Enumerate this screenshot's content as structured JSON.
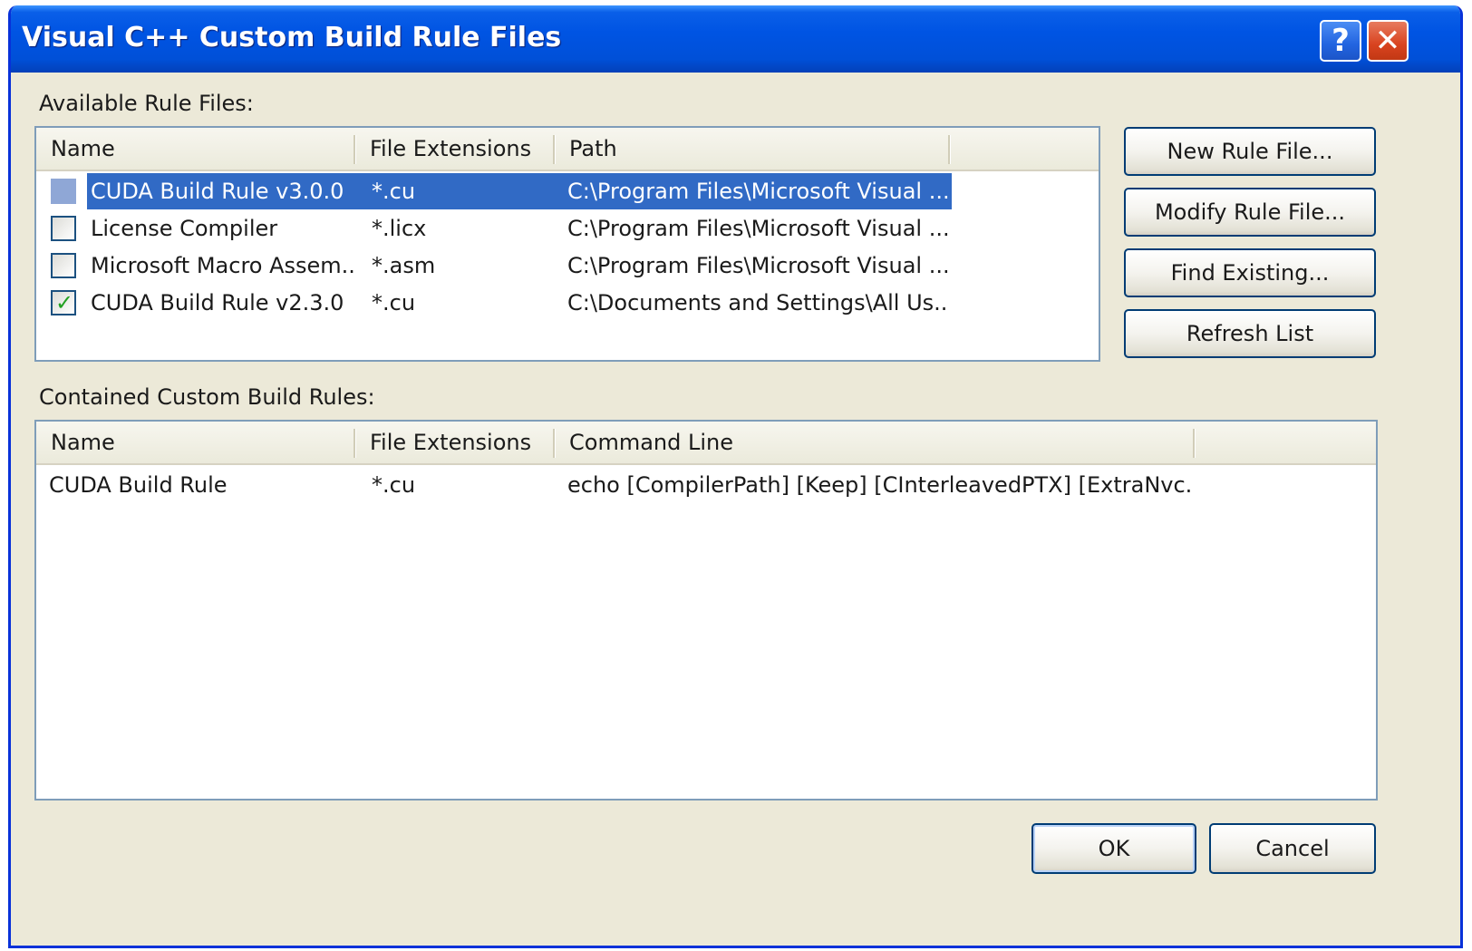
{
  "window": {
    "title": "Visual C++ Custom Build Rule Files",
    "help_label": "?",
    "close_label": "✕"
  },
  "available": {
    "label": "Available Rule Files:",
    "columns": [
      "Name",
      "File Extensions",
      "Path"
    ],
    "rows": [
      {
        "name": "CUDA Build Rule v3.0.0",
        "ext": "*.cu",
        "path": "C:\\Program Files\\Microsoft Visual ...",
        "checked": false,
        "selected": true
      },
      {
        "name": "License Compiler",
        "ext": "*.licx",
        "path": "C:\\Program Files\\Microsoft Visual ...",
        "checked": false,
        "selected": false
      },
      {
        "name": "Microsoft Macro Assem...",
        "ext": "*.asm",
        "path": "C:\\Program Files\\Microsoft Visual ...",
        "checked": false,
        "selected": false
      },
      {
        "name": "CUDA Build Rule v2.3.0",
        "ext": "*.cu",
        "path": "C:\\Documents and Settings\\All Us...",
        "checked": true,
        "selected": false
      }
    ],
    "buttons": {
      "new": "New Rule File...",
      "modify": "Modify Rule File...",
      "find": "Find Existing...",
      "refresh": "Refresh List"
    }
  },
  "contained": {
    "label": "Contained Custom Build Rules:",
    "columns": [
      "Name",
      "File Extensions",
      "Command Line"
    ],
    "rows": [
      {
        "name": "CUDA Build Rule",
        "ext": "*.cu",
        "command": "echo [CompilerPath] [Keep] [CInterleavedPTX] [ExtraNvc..."
      }
    ]
  },
  "footer": {
    "ok": "OK",
    "cancel": "Cancel"
  },
  "colors": {
    "selection": "#316ac5",
    "titlebar": "#0054e3",
    "dialog_bg": "#ece9d8"
  }
}
